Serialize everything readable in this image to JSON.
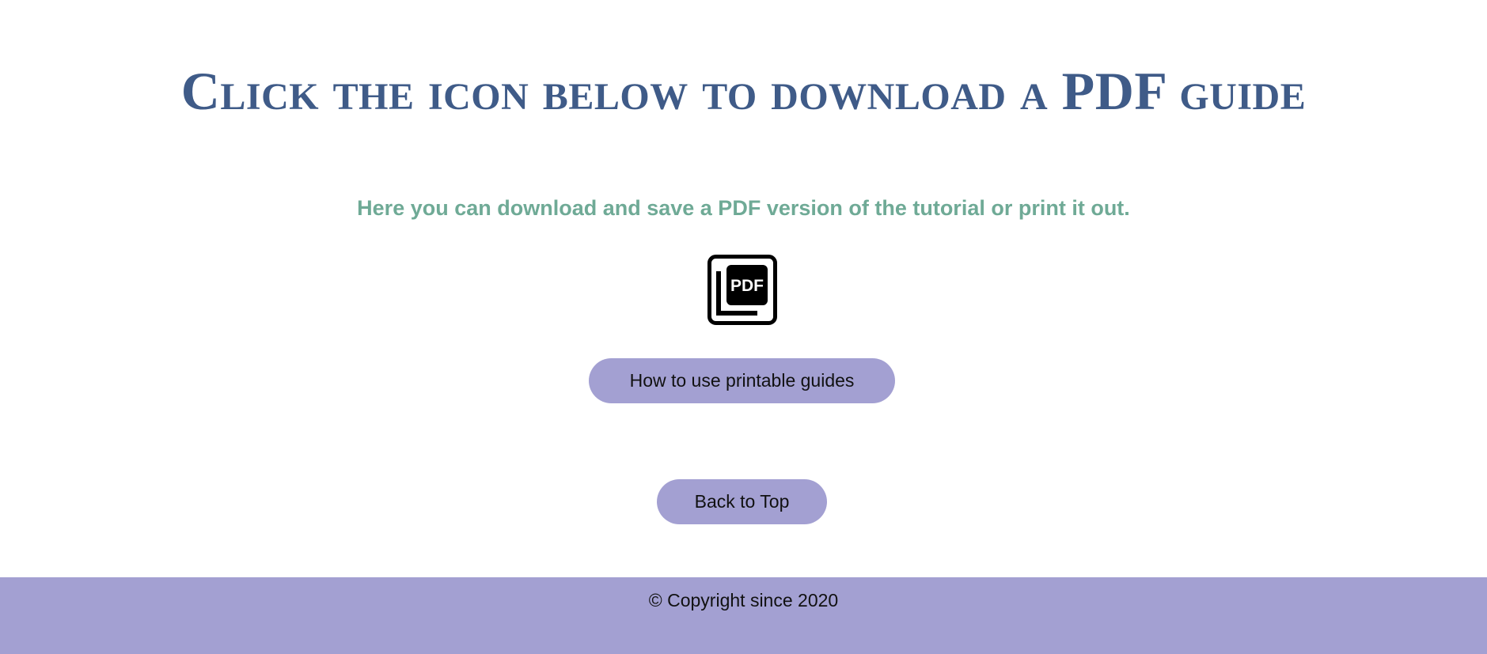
{
  "main": {
    "title": "Click the icon below to download a PDF guide",
    "subtitle": "Here you can download and save a PDF version of the tutorial or print it out.",
    "pdf_icon": {
      "icon": "pdf-file-icon",
      "label": "PDF"
    },
    "guide_button_label": "How to use printable guides",
    "back_to_top_label": "Back to Top"
  },
  "footer": {
    "copyright": "© Copyright since 2020"
  },
  "colors": {
    "title": "#3f5b88",
    "subtitle": "#6faa96",
    "accent": "#a3a0d2",
    "background": "#ffffff"
  }
}
